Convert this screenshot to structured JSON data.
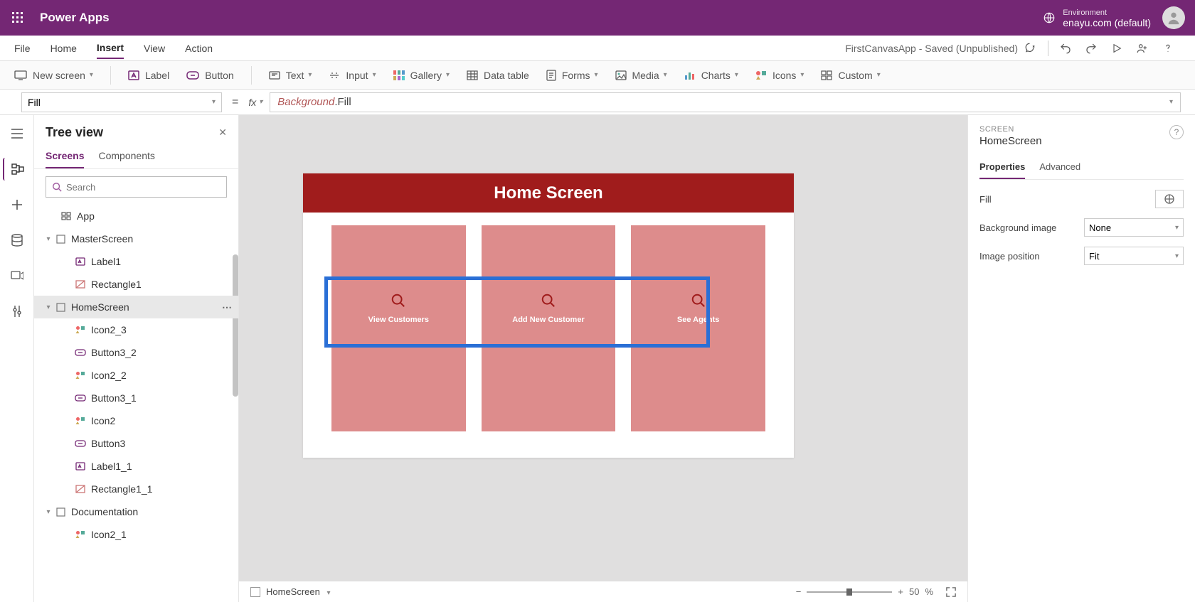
{
  "header": {
    "app_title": "Power Apps",
    "env_label": "Environment",
    "env_name": "enayu.com (default)"
  },
  "menubar": {
    "items": [
      "File",
      "Home",
      "Insert",
      "View",
      "Action"
    ],
    "active_index": 2,
    "title_status": "FirstCanvasApp - Saved (Unpublished)"
  },
  "ribbon": {
    "new_screen": "New screen",
    "label": "Label",
    "button": "Button",
    "text": "Text",
    "input": "Input",
    "gallery": "Gallery",
    "data_table": "Data table",
    "forms": "Forms",
    "media": "Media",
    "charts": "Charts",
    "icons": "Icons",
    "custom": "Custom"
  },
  "formula": {
    "property": "Fill",
    "fx_label": "fx",
    "object": "Background",
    "prop": ".Fill"
  },
  "treeview": {
    "title": "Tree view",
    "tab_screens": "Screens",
    "tab_components": "Components",
    "search_placeholder": "Search",
    "nodes": [
      {
        "label": "App",
        "indent": 0,
        "type": "app"
      },
      {
        "label": "MasterScreen",
        "indent": 0,
        "type": "screen",
        "expanded": true
      },
      {
        "label": "Label1",
        "indent": 1,
        "type": "label"
      },
      {
        "label": "Rectangle1",
        "indent": 1,
        "type": "rect"
      },
      {
        "label": "HomeScreen",
        "indent": 0,
        "type": "screen",
        "expanded": true,
        "selected": true
      },
      {
        "label": "Icon2_3",
        "indent": 1,
        "type": "icon"
      },
      {
        "label": "Button3_2",
        "indent": 1,
        "type": "button"
      },
      {
        "label": "Icon2_2",
        "indent": 1,
        "type": "icon"
      },
      {
        "label": "Button3_1",
        "indent": 1,
        "type": "button"
      },
      {
        "label": "Icon2",
        "indent": 1,
        "type": "icon"
      },
      {
        "label": "Button3",
        "indent": 1,
        "type": "button"
      },
      {
        "label": "Label1_1",
        "indent": 1,
        "type": "label"
      },
      {
        "label": "Rectangle1_1",
        "indent": 1,
        "type": "rect"
      },
      {
        "label": "Documentation",
        "indent": 0,
        "type": "screen",
        "expanded": true
      },
      {
        "label": "Icon2_1",
        "indent": 1,
        "type": "icon"
      }
    ]
  },
  "canvas": {
    "header_title": "Home Screen",
    "tiles": [
      {
        "label": "View Customers"
      },
      {
        "label": "Add New Customer"
      },
      {
        "label": "See Agents"
      }
    ]
  },
  "status": {
    "screen_name": "HomeScreen",
    "zoom_val": "50",
    "zoom_unit": "%"
  },
  "props": {
    "type_label": "SCREEN",
    "name": "HomeScreen",
    "tab_properties": "Properties",
    "tab_advanced": "Advanced",
    "fill_label": "Fill",
    "bg_image_label": "Background image",
    "bg_image_value": "None",
    "img_pos_label": "Image position",
    "img_pos_value": "Fit"
  }
}
